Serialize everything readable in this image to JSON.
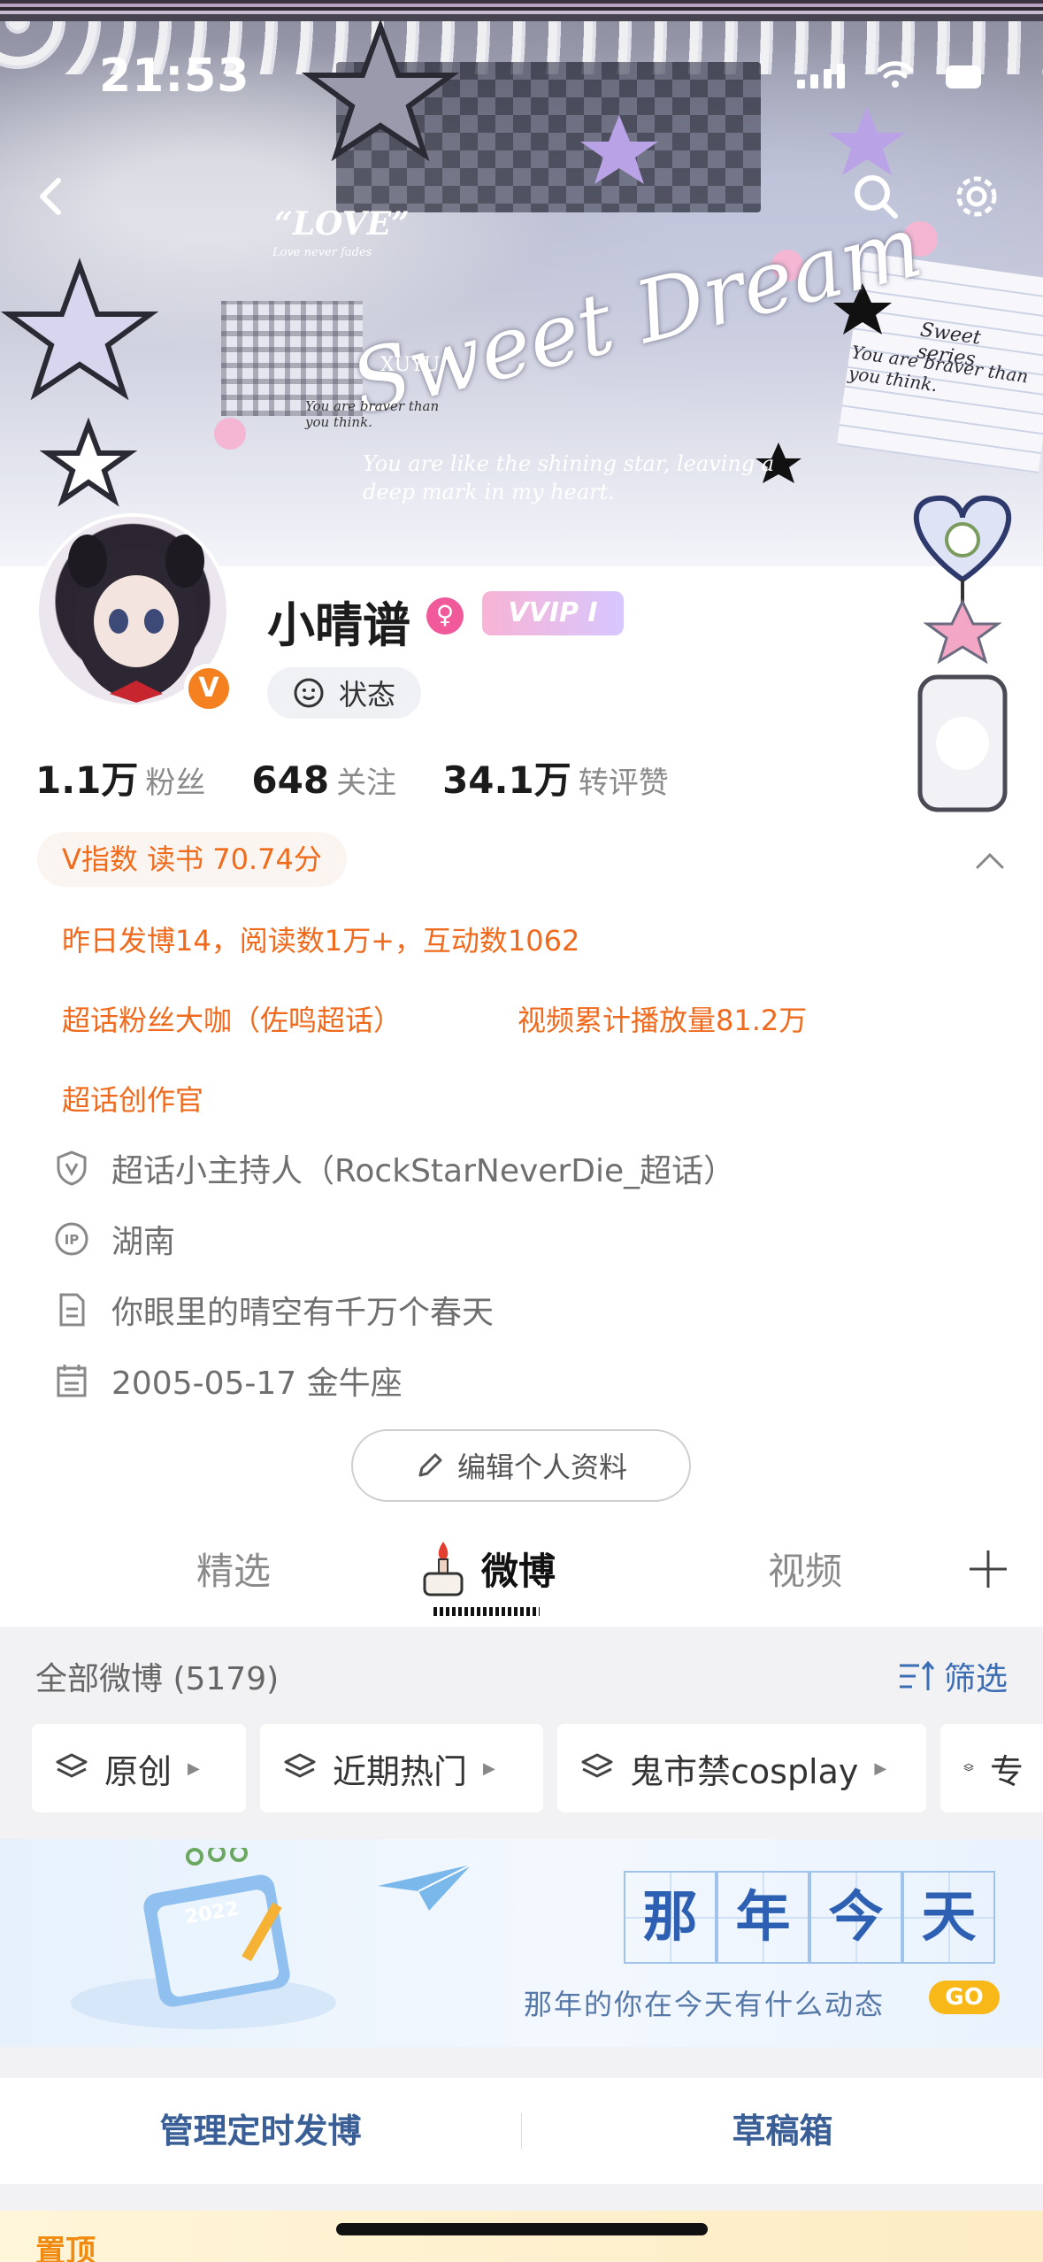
{
  "status_bar": {
    "time": "21:53"
  },
  "banner": {
    "love": "“LOVE”",
    "love_sub": "Love never fades",
    "tag": "XUYU",
    "script_title": "Sweet Dream",
    "quote": "You are like the shining star, leaving a deep mark in my heart.",
    "note": "You are braver than you think.",
    "side_title": "Sweet series",
    "side_note": "You are braver than you think."
  },
  "profile": {
    "name": "小晴谱",
    "vip_label": "VVIP I",
    "status_label": "状态",
    "verified_badge": "V"
  },
  "stats": [
    {
      "num": "1.1万",
      "label": "粉丝"
    },
    {
      "num": "648",
      "label": "关注"
    },
    {
      "num": "34.1万",
      "label": "转评赞"
    }
  ],
  "orange_info": {
    "vindex": "V指数 读书 70.74分",
    "line1": "昨日发博14，阅读数1万+，互动数1062",
    "line2a": "超话粉丝大咖（佐鸣超话）",
    "line2b": "视频累计播放量81.2万",
    "line3": "超话创作官"
  },
  "info_rows": [
    {
      "icon": "shield-v-icon",
      "text": "超话小主持人（RockStarNeverDie_超话）"
    },
    {
      "icon": "ip-icon",
      "text": "湖南"
    },
    {
      "icon": "document-icon",
      "text": "你眼里的晴空有千万个春天"
    },
    {
      "icon": "calendar-icon",
      "text": "2005-05-17 金牛座"
    }
  ],
  "edit_profile": "编辑个人资料",
  "tabs": {
    "featured": "精选",
    "weibo": "微博",
    "video": "视频"
  },
  "feed": {
    "all_title": "全部微博 (5179)",
    "filter": "筛选",
    "chips": [
      "原创",
      "近期热门",
      "鬼市禁cosplay",
      "专"
    ],
    "memory_chars": [
      "那",
      "年",
      "今",
      "天"
    ],
    "memory_sub": "那年的你在今天有什么动态",
    "go": "GO",
    "calendar_year": "2022",
    "action_left": "管理定时发博",
    "action_right": "草稿箱",
    "pinned": "置顶"
  },
  "colors": {
    "orange": "#ef6a1c",
    "link_blue": "#3b6db5",
    "vip_pink": "#f05a9b",
    "badge_orange": "#f5801f"
  }
}
